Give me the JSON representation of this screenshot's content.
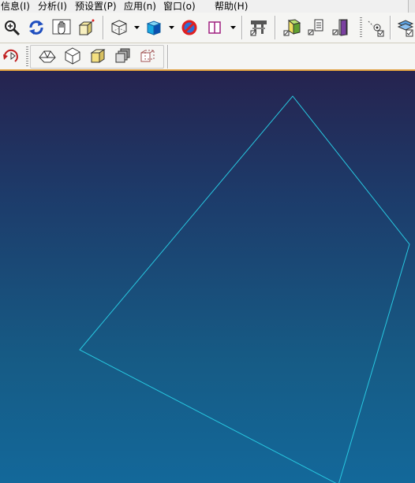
{
  "menu": {
    "items": [
      {
        "label": "信息(I)"
      },
      {
        "label": "分析(I)"
      },
      {
        "label": "预设置(P)"
      },
      {
        "label": "应用(n)"
      },
      {
        "label": "窗口(o)"
      },
      {
        "label": "帮助(H)"
      }
    ]
  },
  "toolbar1": {
    "icons": [
      "zoom-icon",
      "refresh-icon",
      "pan-hand-icon",
      "spin-box-icon",
      "wireframe-cube-icon",
      "shaded-cube-icon",
      "no-display-icon",
      "pane-icon",
      "datum-plane-icon",
      "model-tree-icon",
      "layer-icon",
      "exit-door-icon",
      "point-select-icon",
      "layers-check-icon"
    ]
  },
  "toolbar2": {
    "icons": [
      "redraw-icon",
      "view-shaded-icon",
      "view-wireframe-icon",
      "view-cube-icon",
      "view-stack-icon",
      "view-hidden-icon"
    ]
  },
  "viewport": {
    "colors": {
      "top": "#26234f",
      "bottom": "#13689a",
      "outline": "#28c8e0"
    }
  }
}
